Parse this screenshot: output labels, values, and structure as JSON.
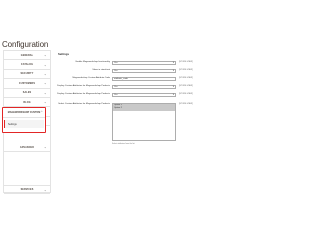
{
  "page": {
    "title": "Configuration"
  },
  "sidebar": {
    "items": [
      {
        "label": "GENERAL"
      },
      {
        "label": "CATALOG"
      },
      {
        "label": "SECURITY"
      },
      {
        "label": "CUSTOMERS"
      },
      {
        "label": "SALES"
      },
      {
        "label": "BLOG"
      },
      {
        "label": "PAYMENT"
      },
      {
        "label": "MAGEWORKSHOP CLOUD"
      }
    ],
    "active_group": {
      "label": "MAGEWORKSHOP CUSTOM",
      "sub_item": "Settings"
    },
    "after_items": [
      {
        "label": "SERVICES"
      },
      {
        "label": "ADVANCED"
      }
    ]
  },
  "main": {
    "section_title": "Settings",
    "rows": [
      {
        "label": "Enable Mageworkshop functionality",
        "value": "Yes",
        "scope": "[STORE VIEW]"
      },
      {
        "label": "Show in storefront",
        "value": "Yes",
        "scope": "[STORE VIEW]"
      },
      {
        "label": "Mageworkshop Custom Attribute Code",
        "value": "attribute_code",
        "scope": "[STORE VIEW]"
      },
      {
        "label": "Display Custom Attributes for Mageworkshop Products",
        "value": "Yes",
        "scope": "[STORE VIEW]"
      },
      {
        "label": "Display Custom Attributes for Mageworkshop Products",
        "value": "Yes",
        "scope": "[STORE VIEW]"
      },
      {
        "label": "Select Custom Attributes for Mageworkshop Products",
        "scope": "[STORE VIEW]",
        "options": [
          "Option 1",
          "Option 2"
        ]
      }
    ],
    "note": "Select attributes from the list"
  }
}
